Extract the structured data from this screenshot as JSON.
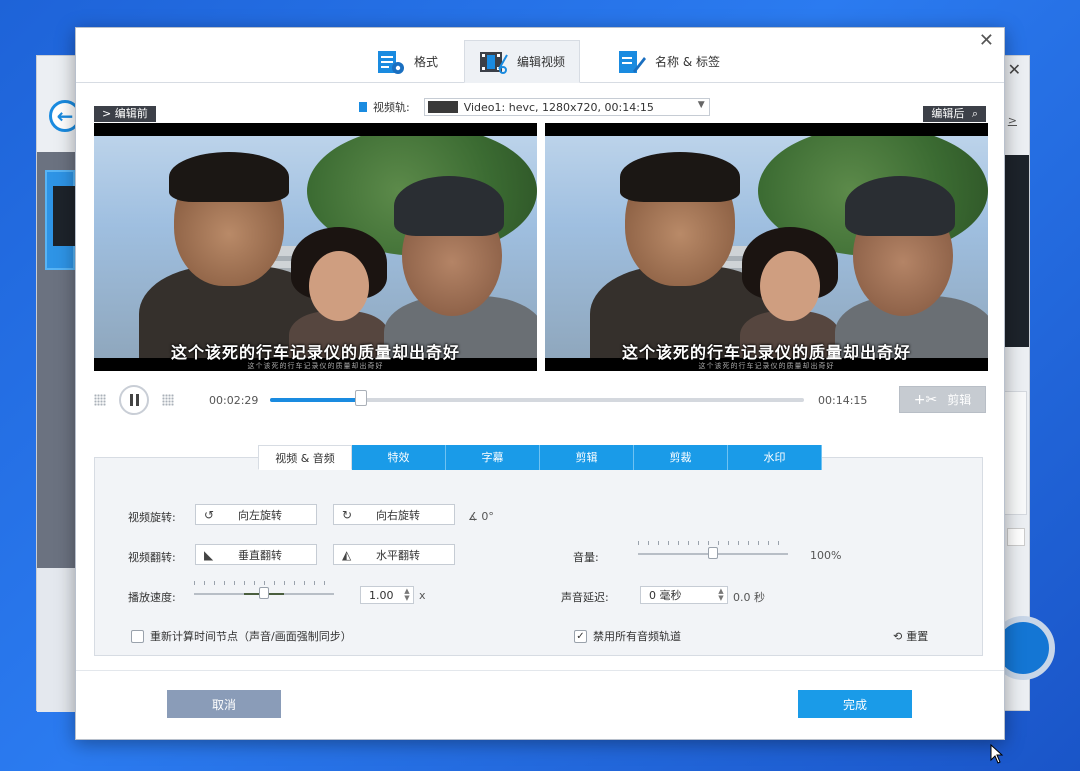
{
  "top_tabs": [
    {
      "label": "格式",
      "icon": "format-settings-icon"
    },
    {
      "label": "编辑视频",
      "icon": "video-edit-icon"
    },
    {
      "label": "名称 & 标签",
      "icon": "tag-edit-icon"
    }
  ],
  "preview": {
    "before_label": "> 编辑前",
    "after_label": "编辑后",
    "track_label": "视频轨:",
    "track_value": "Video1: hevc, 1280x720, 00:14:15",
    "caption": "这个该死的行车记录仪的质量却出奇好",
    "caption_sub": "这个该死的行车记录仪的质量却出奇好"
  },
  "playback": {
    "current_time": "00:02:29",
    "total_time": "00:14:15",
    "progress": 0.17,
    "cut_label": "剪辑"
  },
  "sub_tabs": [
    "视频 & 音频",
    "特效",
    "字幕",
    "剪辑",
    "剪裁",
    "水印"
  ],
  "controls": {
    "rotate_label": "视频旋转:",
    "rotate_left": "向左旋转",
    "rotate_right": "向右旋转",
    "angle": "0°",
    "flip_label": "视频翻转:",
    "flip_vertical": "垂直翻转",
    "flip_horizontal": "水平翻转",
    "speed_label": "播放速度:",
    "speed_value": "1.00",
    "speed_unit": "x",
    "speed_level": 0.5,
    "volume_label": "音量:",
    "volume_value": "100%",
    "volume_level": 0.5,
    "delay_label": "声音延迟:",
    "delay_value": "0 毫秒",
    "delay_unit": "0.0 秒",
    "recalc_label": "重新计算时间节点（声音/画面强制同步）",
    "recalc_checked": false,
    "disable_audio_label": "禁用所有音频轨道",
    "disable_audio_checked": true,
    "reset_label": "重置"
  },
  "footer": {
    "cancel": "取消",
    "done": "完成"
  },
  "background": {
    "link_text": ">"
  }
}
